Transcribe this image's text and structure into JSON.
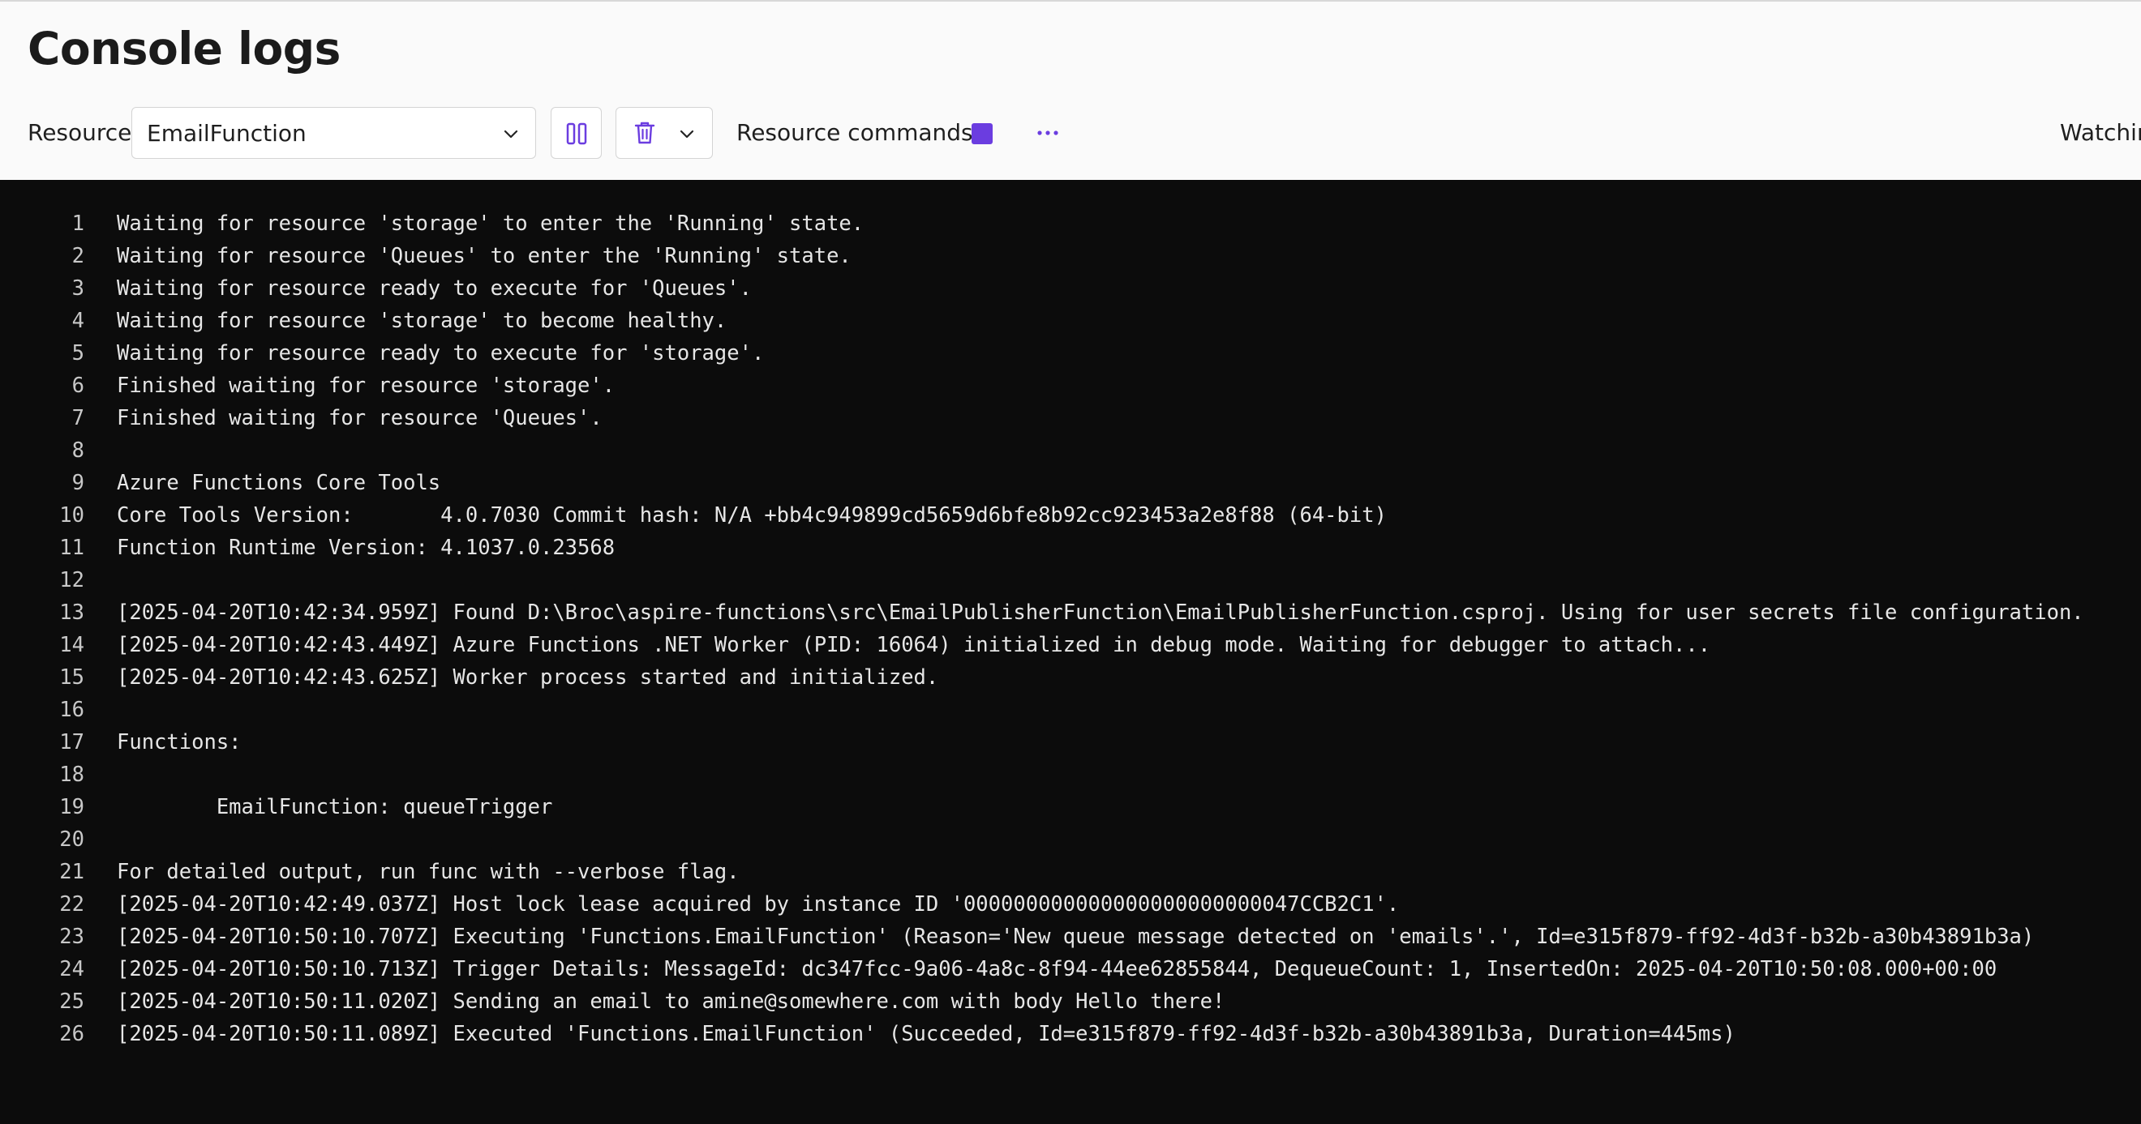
{
  "header": {
    "title": "Console logs",
    "resource_label": "Resource",
    "resource_value": "EmailFunction",
    "resource_commands_label": "Resource commands",
    "watching_text": "Watchin"
  },
  "icons": {
    "resource_dropdown": "chevron-down-icon",
    "pause": "pause-icon",
    "clear": "trash-icon",
    "clear_menu": "chevron-down-icon",
    "stop": "stop-icon",
    "more": "more-horizontal-icon"
  },
  "colors": {
    "accent": "#6b3de0",
    "log_background": "#0c0c0c",
    "log_text": "#e6e6e6",
    "header_background": "#fafafa"
  },
  "log_lines": [
    {
      "num": "1",
      "text": "Waiting for resource 'storage' to enter the 'Running' state."
    },
    {
      "num": "2",
      "text": "Waiting for resource 'Queues' to enter the 'Running' state."
    },
    {
      "num": "3",
      "text": "Waiting for resource ready to execute for 'Queues'."
    },
    {
      "num": "4",
      "text": "Waiting for resource 'storage' to become healthy."
    },
    {
      "num": "5",
      "text": "Waiting for resource ready to execute for 'storage'."
    },
    {
      "num": "6",
      "text": "Finished waiting for resource 'storage'."
    },
    {
      "num": "7",
      "text": "Finished waiting for resource 'Queues'."
    },
    {
      "num": "8",
      "text": ""
    },
    {
      "num": "9",
      "text": "Azure Functions Core Tools"
    },
    {
      "num": "10",
      "text": "Core Tools Version:       4.0.7030 Commit hash: N/A +bb4c949899cd5659d6bfe8b92cc923453a2e8f88 (64-bit)"
    },
    {
      "num": "11",
      "text": "Function Runtime Version: 4.1037.0.23568"
    },
    {
      "num": "12",
      "text": ""
    },
    {
      "num": "13",
      "text": "[2025-04-20T10:42:34.959Z] Found D:\\Broc\\aspire-functions\\src\\EmailPublisherFunction\\EmailPublisherFunction.csproj. Using for user secrets file configuration."
    },
    {
      "num": "14",
      "text": "[2025-04-20T10:42:43.449Z] Azure Functions .NET Worker (PID: 16064) initialized in debug mode. Waiting for debugger to attach..."
    },
    {
      "num": "15",
      "text": "[2025-04-20T10:42:43.625Z] Worker process started and initialized."
    },
    {
      "num": "16",
      "text": ""
    },
    {
      "num": "17",
      "text": "Functions:"
    },
    {
      "num": "18",
      "text": ""
    },
    {
      "num": "19",
      "text": "        EmailFunction: queueTrigger"
    },
    {
      "num": "20",
      "text": ""
    },
    {
      "num": "21",
      "text": "For detailed output, run func with --verbose flag."
    },
    {
      "num": "22",
      "text": "[2025-04-20T10:42:49.037Z] Host lock lease acquired by instance ID '000000000000000000000000047CCB2C1'."
    },
    {
      "num": "23",
      "text": "[2025-04-20T10:50:10.707Z] Executing 'Functions.EmailFunction' (Reason='New queue message detected on 'emails'.', Id=e315f879-ff92-4d3f-b32b-a30b43891b3a)"
    },
    {
      "num": "24",
      "text": "[2025-04-20T10:50:10.713Z] Trigger Details: MessageId: dc347fcc-9a06-4a8c-8f94-44ee62855844, DequeueCount: 1, InsertedOn: 2025-04-20T10:50:08.000+00:00"
    },
    {
      "num": "25",
      "text": "[2025-04-20T10:50:11.020Z] Sending an email to amine@somewhere.com with body Hello there!"
    },
    {
      "num": "26",
      "text": "[2025-04-20T10:50:11.089Z] Executed 'Functions.EmailFunction' (Succeeded, Id=e315f879-ff92-4d3f-b32b-a30b43891b3a, Duration=445ms)"
    }
  ]
}
